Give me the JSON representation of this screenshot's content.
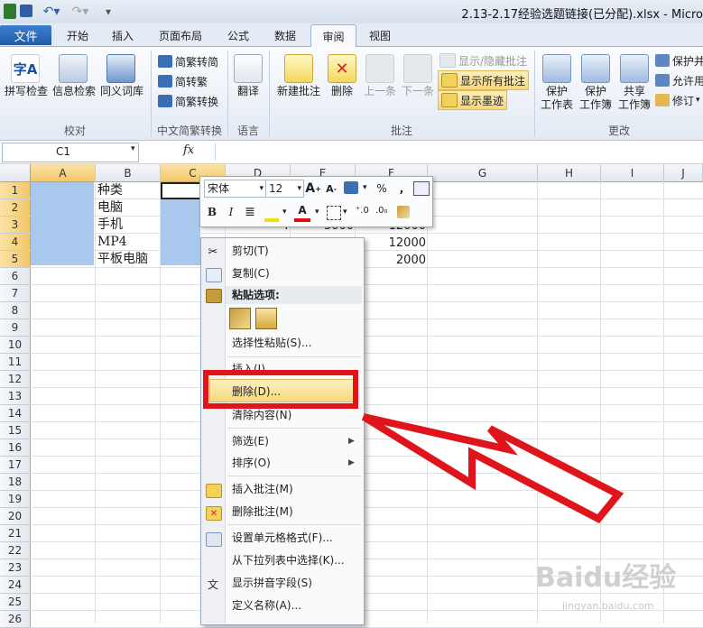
{
  "window": {
    "title": "2.13-2.17经验选题链接(已分配).xlsx - Micro",
    "quick_access": [
      "save",
      "undo",
      "redo"
    ]
  },
  "tabs": [
    "文件",
    "开始",
    "插入",
    "页面布局",
    "公式",
    "数据",
    "审阅",
    "视图"
  ],
  "active_tab": "审阅",
  "ribbon": {
    "proofing": {
      "label": "校对",
      "buttons": [
        "拼写检查",
        "信息检索",
        "同义词库"
      ]
    },
    "chinese_conversion": {
      "label": "中文简繁转换",
      "buttons": [
        "简繁转简",
        "简转繁",
        "简繁转换"
      ]
    },
    "language": {
      "label": "语言",
      "buttons": [
        "翻译"
      ]
    },
    "comments": {
      "label": "批注",
      "buttons": [
        "新建批注",
        "删除",
        "上一条",
        "下一条"
      ],
      "toggles": [
        "显示/隐藏批注",
        "显示所有批注",
        "显示墨迹"
      ]
    },
    "changes": {
      "label": "更改",
      "buttons": [
        "保护",
        "工作表",
        "保护",
        "工作簿",
        "共享",
        "工作簿"
      ],
      "side": [
        "保护并",
        "允许用",
        "修订"
      ]
    }
  },
  "formula_bar": {
    "name_box": "C1",
    "fx": "fx"
  },
  "columns": [
    "A",
    "B",
    "C",
    "D",
    "E",
    "F",
    "G",
    "H",
    "I",
    "J"
  ],
  "rows": [
    "1",
    "2",
    "3",
    "4",
    "5",
    "6",
    "7",
    "8",
    "9",
    "10",
    "11",
    "12",
    "13",
    "14",
    "15",
    "16",
    "17",
    "18",
    "19",
    "20",
    "21",
    "22",
    "23",
    "24",
    "25",
    "26"
  ],
  "cells": {
    "B1": "种类",
    "B2": "电脑",
    "B3": "手机",
    "B4": "MP4",
    "B5": "平板电脑",
    "D3": "4",
    "E3": "3000",
    "F3": "12000",
    "F4": "12000",
    "F5": "2000"
  },
  "mini_toolbar": {
    "font": "宋体",
    "size": "12",
    "row2": [
      "B",
      "I",
      "%",
      ","
    ]
  },
  "context_menu": {
    "items": [
      "剪切(T)",
      "复制(C)",
      "粘贴选项:",
      "选择性粘贴(S)...",
      "插入(I)",
      "删除(D)...",
      "清除内容(N)",
      "筛选(E)",
      "排序(O)",
      "插入批注(M)",
      "删除批注(M)",
      "设置单元格格式(F)...",
      "从下拉列表中选择(K)...",
      "显示拼音字段(S)",
      "定义名称(A)..."
    ],
    "highlighted": "删除(D)..."
  },
  "colors": {
    "accent_red": "#e0151c",
    "selection": "#a9c8ee",
    "file_tab": "#2a66b8"
  },
  "watermark": {
    "brand": "Baidu经验",
    "url": "jingyan.baidu.com"
  }
}
